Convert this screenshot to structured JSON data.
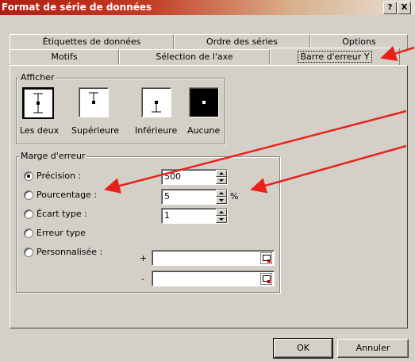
{
  "window": {
    "title": "Format de série de données",
    "help_label": "?",
    "close_label": "X"
  },
  "tabs_row1": [
    {
      "label": "Étiquettes de données"
    },
    {
      "label": "Ordre des séries"
    },
    {
      "label": "Options"
    }
  ],
  "tabs_row2": [
    {
      "label": "Motifs"
    },
    {
      "label": "Sélection de l'axe"
    },
    {
      "label": "Barre d'erreur Y",
      "active": true
    }
  ],
  "afficher": {
    "title": "Afficher",
    "options": [
      {
        "label": "Les deux",
        "icon": "error-bar-both-icon",
        "selected": true
      },
      {
        "label": "Supérieure",
        "icon": "error-bar-plus-icon"
      },
      {
        "label": "Inférieure",
        "icon": "error-bar-minus-icon"
      },
      {
        "label": "Aucune",
        "icon": "error-bar-none-icon"
      }
    ]
  },
  "marge": {
    "title": "Marge d'erreur",
    "options": [
      {
        "label": "Précision :",
        "checked": true,
        "value": "500"
      },
      {
        "label": "Pourcentage :",
        "value": "5",
        "unit": "%"
      },
      {
        "label": "Écart type :",
        "value": "1"
      },
      {
        "label": "Erreur type"
      },
      {
        "label": "Personnalisée :"
      }
    ],
    "plus_label": "+",
    "minus_label": "-"
  },
  "buttons": {
    "ok": "OK",
    "cancel": "Annuler"
  },
  "colors": {
    "arrow": "#e8221b",
    "titlebar_start": "#b01e12"
  }
}
